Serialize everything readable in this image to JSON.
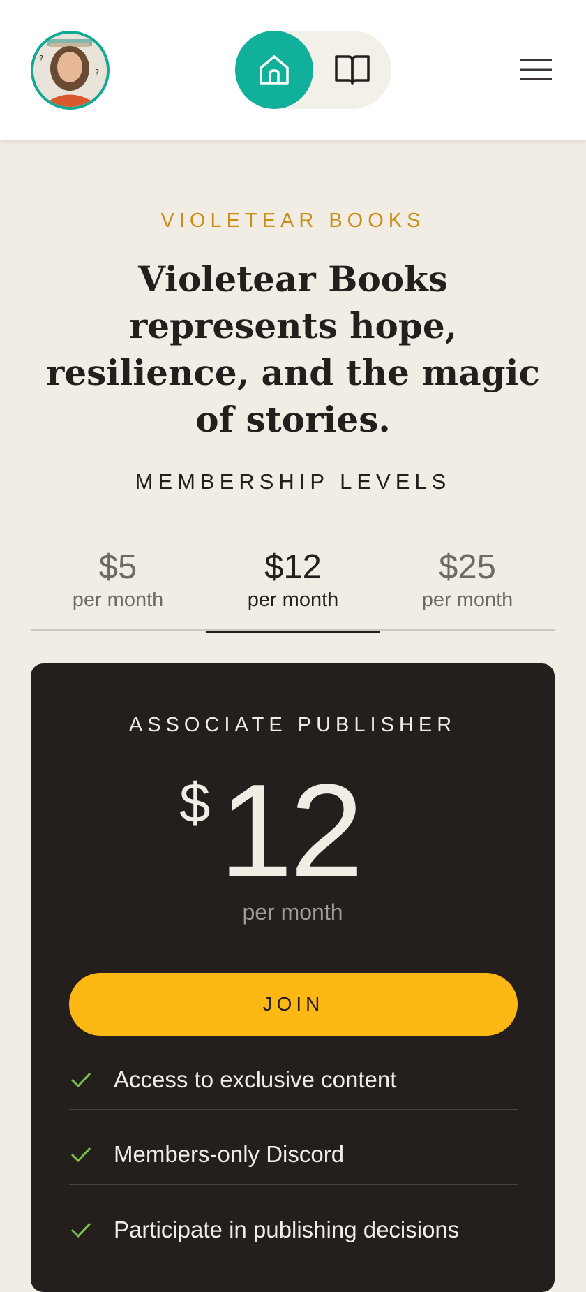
{
  "header": {
    "avatar_alt": "Creator avatar",
    "nav_toggle": {
      "home_icon": "home-icon",
      "book_icon": "open-book-icon",
      "active": "home"
    },
    "menu_icon": "hamburger-menu-icon"
  },
  "hero": {
    "eyebrow": "VIOLETEAR BOOKS",
    "headline": "Violetear Books represents hope, resilience, and the magic of stories."
  },
  "membership": {
    "title": "MEMBERSHIP LEVELS",
    "tabs": [
      {
        "price": "$5",
        "period": "per month",
        "active": false
      },
      {
        "price": "$12",
        "period": "per month",
        "active": true
      },
      {
        "price": "$25",
        "period": "per month",
        "active": false
      }
    ],
    "selected": {
      "name": "ASSOCIATE PUBLISHER",
      "currency": "$",
      "amount": "12",
      "period": "per month",
      "join_label": "JOIN",
      "benefits": [
        "Access to exclusive content",
        "Members-only Discord",
        "Participate in publishing decisions"
      ]
    }
  },
  "colors": {
    "accent_teal": "#11b09b",
    "eyebrow_gold": "#c98e17",
    "join_yellow": "#fdb813",
    "card_dark": "#241f1d",
    "page_bg": "#f1ede5",
    "check_green": "#7cc24a"
  }
}
